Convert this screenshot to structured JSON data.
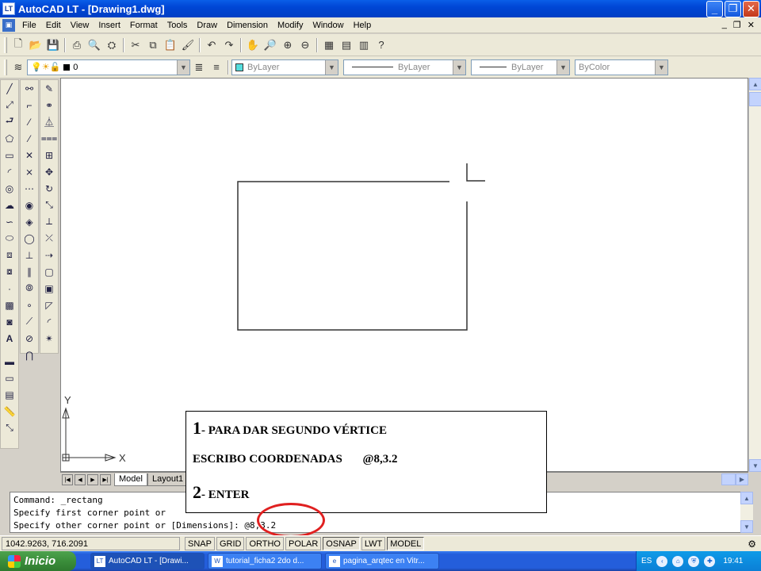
{
  "window": {
    "title": "AutoCAD LT - [Drawing1.dwg]",
    "app_badge": "LT"
  },
  "menus": [
    "File",
    "Edit",
    "View",
    "Insert",
    "Format",
    "Tools",
    "Draw",
    "Dimension",
    "Modify",
    "Window",
    "Help"
  ],
  "properties": {
    "layer": "0",
    "color": "ByLayer",
    "linetype": "ByLayer",
    "lineweight": "ByLayer",
    "plotstyle": "ByColor"
  },
  "ucs": {
    "x_label": "X",
    "y_label": "Y"
  },
  "layout_tabs": [
    "Model",
    "Layout1"
  ],
  "command_lines": [
    "Command: _rectang",
    "Specify first corner point or",
    "Specify other corner point or [Dimensions]: @8,3.2"
  ],
  "status": {
    "coordinates": "1042.9263, 716.2091",
    "toggles": [
      "SNAP",
      "GRID",
      "ORTHO",
      "POLAR",
      "OSNAP",
      "LWT",
      "MODEL"
    ]
  },
  "annotation": {
    "step1_number": "1",
    "step1_text": "- PARA DAR SEGUNDO VÉRTICE",
    "step1_detail": "ESCRIBO COORDENADAS",
    "coordinate": "@8,3.2",
    "step2_number": "2",
    "step2_text": "- ENTER",
    "highlight_color": "#e02020"
  },
  "taskbar": {
    "start": "Inicio",
    "tasks": [
      "AutoCAD LT - [Drawi...",
      "tutorial_ficha2 2do d...",
      "pagina_arqtec en Vitr..."
    ],
    "language": "ES",
    "time": "19:41"
  }
}
